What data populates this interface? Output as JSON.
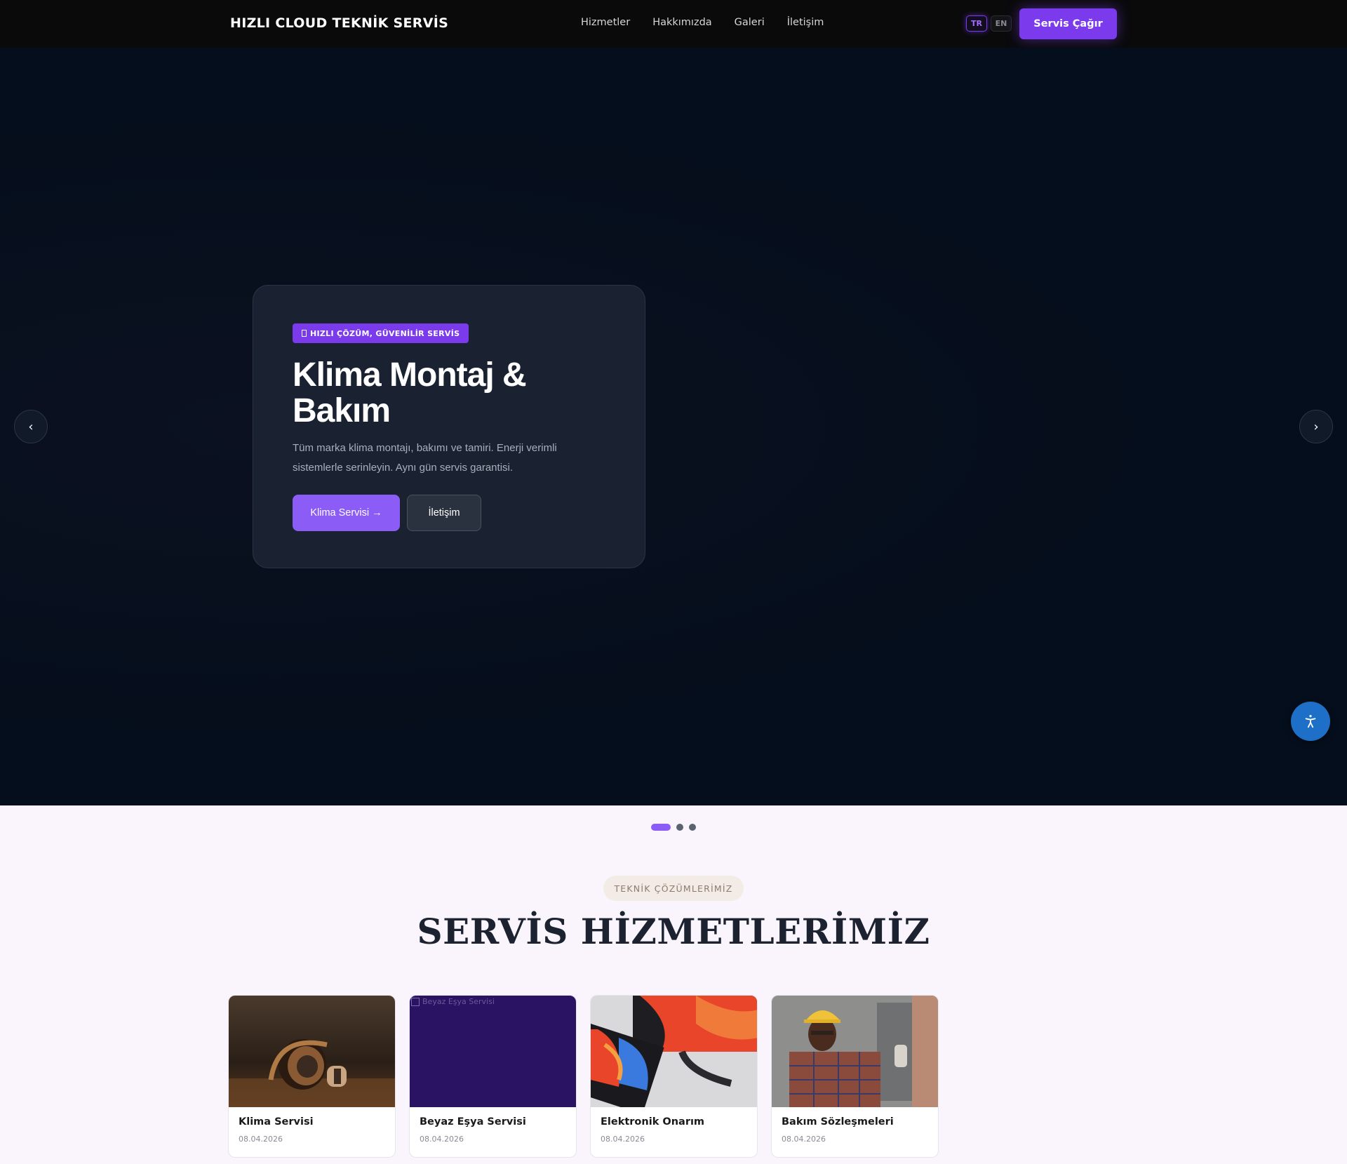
{
  "header": {
    "brand": "HIZLI CLOUD TEKNİK SERVİS",
    "menu": [
      "Hizmetler",
      "Hakkımızda",
      "Galeri",
      "İletişim"
    ],
    "lang_tr": "TR",
    "lang_en": "EN",
    "cta_label": "Servis Çağır",
    "accent_color": "#7c3aed"
  },
  "hero": {
    "badge": "HIZLI ÇÖZÜM, GÜVENİLİR SERVİS",
    "title": "Klima Montaj & Bakım",
    "description": "Tüm marka klima montajı, bakımı ve tamiri. Enerji verimli sistemlerle serinleyin. Aynı gün servis garantisi.",
    "primary_button": "Klima Servisi →",
    "secondary_button": "İletişim",
    "prev_arrow": "‹",
    "next_arrow": "›",
    "slide_count": 3,
    "active_slide": 1,
    "bg_color": "#050e1c"
  },
  "services": {
    "pill": "TEKNİK ÇÖZÜMLERİMİZ",
    "title": "SERVİS HİZMETLERİMİZ",
    "cards": [
      {
        "title": "Klima Servisi",
        "date": "08.04.2026",
        "image": "headphones-on-wood"
      },
      {
        "title": "Beyaz Eşya Servisi",
        "date": "08.04.2026",
        "image": "broken-image",
        "alt": "Beyaz Eşya Servisi"
      },
      {
        "title": "Elektronik Onarım",
        "date": "08.04.2026",
        "image": "laptop-and-monitor"
      },
      {
        "title": "Bakım Sözleşmeleri",
        "date": "08.04.2026",
        "image": "technician-hard-hat"
      }
    ]
  },
  "icons": {
    "accessibility": "accessibility-icon"
  }
}
